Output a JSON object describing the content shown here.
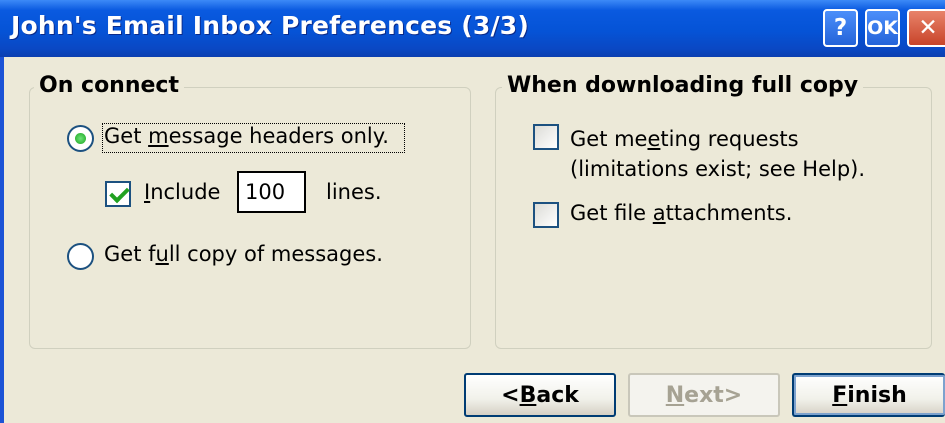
{
  "window": {
    "title": "John's Email Inbox Preferences (3/3)",
    "titlebar_buttons": {
      "help": "?",
      "ok": "OK",
      "close": "✕"
    }
  },
  "on_connect": {
    "legend": "On connect",
    "headers_only": {
      "pre": "Get ",
      "mnemonic": "m",
      "post": "essage headers only.",
      "selected": true
    },
    "include": {
      "mnemonic": "I",
      "post": "nclude",
      "checked": true
    },
    "lines_value": "100",
    "lines_label": "lines.",
    "full_copy": {
      "pre": "Get f",
      "mnemonic": "u",
      "post": "ll copy of messages.",
      "selected": false
    }
  },
  "when_downloading": {
    "legend": "When downloading full copy",
    "meeting_requests": {
      "pre": "Get me",
      "mnemonic": "e",
      "post": "ting requests",
      "line2": "(limitations exist; see Help).",
      "checked": false
    },
    "file_attachments": {
      "pre": "Get file ",
      "mnemonic": "a",
      "post": "ttachments.",
      "checked": false
    }
  },
  "footer": {
    "back": {
      "pre": "<",
      "mnemonic": "B",
      "post": "ack"
    },
    "next": {
      "pre": "",
      "mnemonic": "N",
      "post": "ext>"
    },
    "finish": {
      "pre": "",
      "mnemonic": "F",
      "post": "inish"
    }
  },
  "colors": {
    "titlebar": "#0553d6",
    "dialog_bg": "#ece9d8",
    "check_green": "#21a121"
  }
}
